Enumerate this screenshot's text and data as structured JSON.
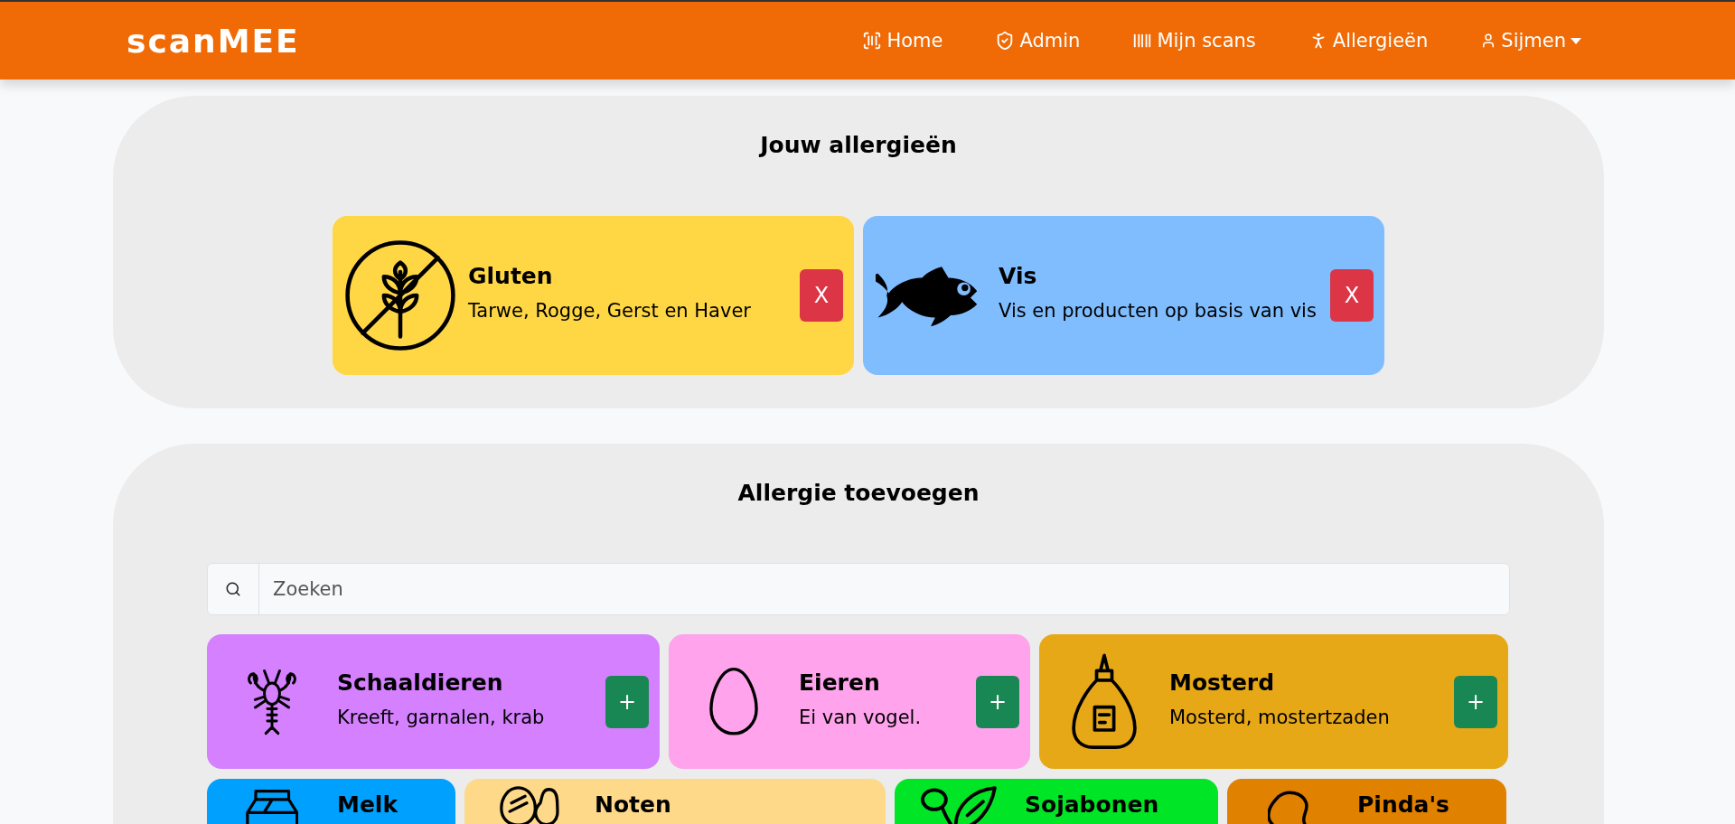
{
  "navbar": {
    "logo": "scanMEE",
    "links": [
      {
        "label": "Home"
      },
      {
        "label": "Admin"
      },
      {
        "label": "Mijn scans"
      },
      {
        "label": "Allergieën"
      }
    ],
    "user_menu": {
      "label": "Sijmen"
    }
  },
  "my_allergies": {
    "title": "Jouw allergieën",
    "items": [
      {
        "name": "Gluten",
        "description": "Tarwe, Rogge, Gerst en Haver",
        "color": "#ffd643",
        "button": "X"
      },
      {
        "name": "Vis",
        "description": "Vis en producten op basis van vis",
        "color": "#80bdff",
        "button": "X"
      }
    ]
  },
  "add_allergy": {
    "title": "Allergie toevoegen",
    "search": {
      "placeholder": "Zoeken"
    },
    "items": [
      {
        "name": "Schaaldieren",
        "description": "Kreeft, garnalen, krab",
        "color": "#d580ff",
        "button": "+"
      },
      {
        "name": "Eieren",
        "description": "Ei van vogel.",
        "color": "#ffa3ec",
        "button": "+"
      },
      {
        "name": "Mosterd",
        "description": "Mosterd, mostertzaden",
        "color": "#e6a817",
        "button": "+"
      },
      {
        "name": "Melk",
        "color": "#00a0ff"
      },
      {
        "name": "Noten",
        "color": "#ffd98a"
      },
      {
        "name": "Sojabonen",
        "color": "#00e626"
      },
      {
        "name": "Pinda's",
        "color": "#e08100"
      }
    ]
  }
}
